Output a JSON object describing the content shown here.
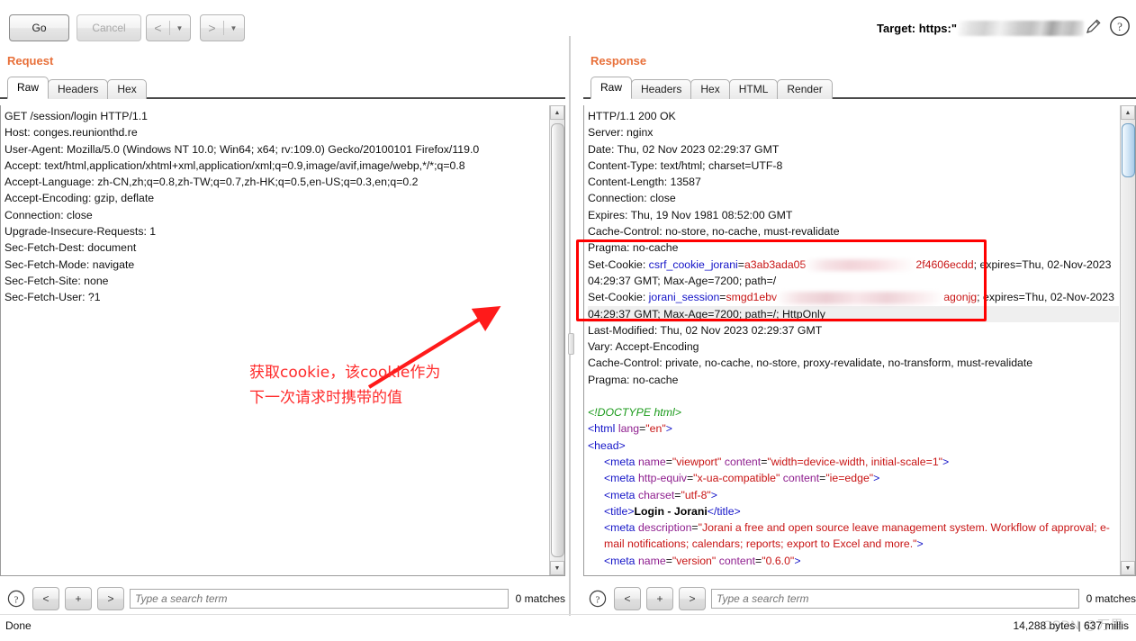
{
  "toolbar": {
    "go_label": "Go",
    "cancel_label": "Cancel",
    "back_glyph": "<",
    "forward_glyph": ">",
    "dropdown_glyph": "▼",
    "target_label": "Target: https:\"",
    "pencil_icon": "pencil-icon",
    "help_icon": "help-icon"
  },
  "request": {
    "title": "Request",
    "tabs": [
      {
        "label": "Raw",
        "active": true
      },
      {
        "label": "Headers",
        "active": false
      },
      {
        "label": "Hex",
        "active": false
      }
    ],
    "raw": "GET /session/login HTTP/1.1\nHost: conges.reunionthd.re\nUser-Agent: Mozilla/5.0 (Windows NT 10.0; Win64; x64; rv:109.0) Gecko/20100101 Firefox/119.0\nAccept: text/html,application/xhtml+xml,application/xml;q=0.9,image/avif,image/webp,*/*;q=0.8\nAccept-Language: zh-CN,zh;q=0.8,zh-TW;q=0.7,zh-HK;q=0.5,en-US;q=0.3,en;q=0.2\nAccept-Encoding: gzip, deflate\nConnection: close\nUpgrade-Insecure-Requests: 1\nSec-Fetch-Dest: document\nSec-Fetch-Mode: navigate\nSec-Fetch-Site: none\nSec-Fetch-User: ?1\n",
    "search_placeholder": "Type a search term",
    "matches": "0 matches",
    "nav_prev": "<",
    "nav_add": "+",
    "nav_next": ">"
  },
  "response": {
    "title": "Response",
    "tabs": [
      {
        "label": "Raw",
        "active": true
      },
      {
        "label": "Headers",
        "active": false
      },
      {
        "label": "Hex",
        "active": false
      },
      {
        "label": "HTML",
        "active": false
      },
      {
        "label": "Render",
        "active": false
      }
    ],
    "status_line": "HTTP/1.1 200 OK",
    "headers_before": [
      "Server: nginx",
      "Date: Thu, 02 Nov 2023 02:29:37 GMT",
      "Content-Type: text/html; charset=UTF-8",
      "Content-Length: 13587",
      "Connection: close",
      "Expires: Thu, 19 Nov 1981 08:52:00 GMT",
      "Cache-Control: no-store, no-cache, must-revalidate"
    ],
    "boxed": {
      "pragma": "Pragma: no-cache",
      "cookie1_prefix": "Set-Cookie: ",
      "cookie1_name": "csrf_cookie_jorani",
      "cookie1_value_start": "a3ab3ada05",
      "cookie1_value_end": "2f4606ecdd",
      "cookie1_suffix": "; expires=Thu, 02-Nov-2023",
      "cookie1_line2": "04:29:37 GMT; Max-Age=7200; path=/",
      "cookie2_prefix": "Set-Cookie: ",
      "cookie2_name": "jorani_session",
      "cookie2_value_start": "smgd1ebv",
      "cookie2_value_end": "agonjg",
      "cookie2_suffix": "; expires=Thu, 02-Nov-2023"
    },
    "highlight_line": "04:29:37 GMT; Max-Age=7200; path=/; HttpOnly",
    "headers_after": [
      "Last-Modified: Thu, 02 Nov 2023 02:29:37 GMT",
      "Vary: Accept-Encoding",
      "Cache-Control: private, no-cache, no-store, proxy-revalidate, no-transform, must-revalidate",
      "Pragma: no-cache"
    ],
    "body": {
      "doctype": "<!DOCTYPE html>",
      "html_open_tag": "<html ",
      "html_attr": "lang",
      "html_attr_val": "\"en\"",
      "html_close": ">",
      "head_tag": "<head>",
      "meta1_tag": "<meta ",
      "meta1_attr1": "name",
      "meta1_val1": "\"viewport\"",
      "meta1_attr2": "content",
      "meta1_val2": "\"width=device-width, initial-scale=1\"",
      "meta2_tag": "<meta ",
      "meta2_attr1": "http-equiv",
      "meta2_val1": "\"x-ua-compatible\"",
      "meta2_attr2": "content",
      "meta2_val2": "\"ie=edge\"",
      "meta3_tag": "<meta ",
      "meta3_attr1": "charset",
      "meta3_val1": "\"utf-8\"",
      "title_open": "<title>",
      "title_text": "Login - Jorani",
      "title_close": "</title>",
      "meta4_tag": "<meta ",
      "meta4_attr1": "description",
      "meta4_val1": "\"Jorani a free and open source leave management system. Workflow of approval; e-mail notifications; calendars; reports; export to Excel and more.\"",
      "meta5_tag": "<meta ",
      "meta5_attr1": "name",
      "meta5_val1": "\"version\"",
      "meta5_attr2": "content",
      "meta5_val2": "\"0.6.0\""
    },
    "search_placeholder": "Type a search term",
    "matches": "0 matches",
    "nav_prev": "<",
    "nav_add": "+",
    "nav_next": ">"
  },
  "annotation": {
    "line1": "获取cookie，该cookie作为",
    "line2": "下一次请求时携带的值",
    "color": "#ff2a2a"
  },
  "statusbar": {
    "left": "Done",
    "right": "14,288 bytes | 637 millis",
    "watermark": "CSDN @万里"
  },
  "colors": {
    "accent": "#e8703a",
    "annotation_red": "#ff0000",
    "tag_blue": "#1414c8",
    "attr_purple": "#8f1f8f",
    "value_red": "#c81414",
    "doctype_green": "#1a9a1a"
  }
}
